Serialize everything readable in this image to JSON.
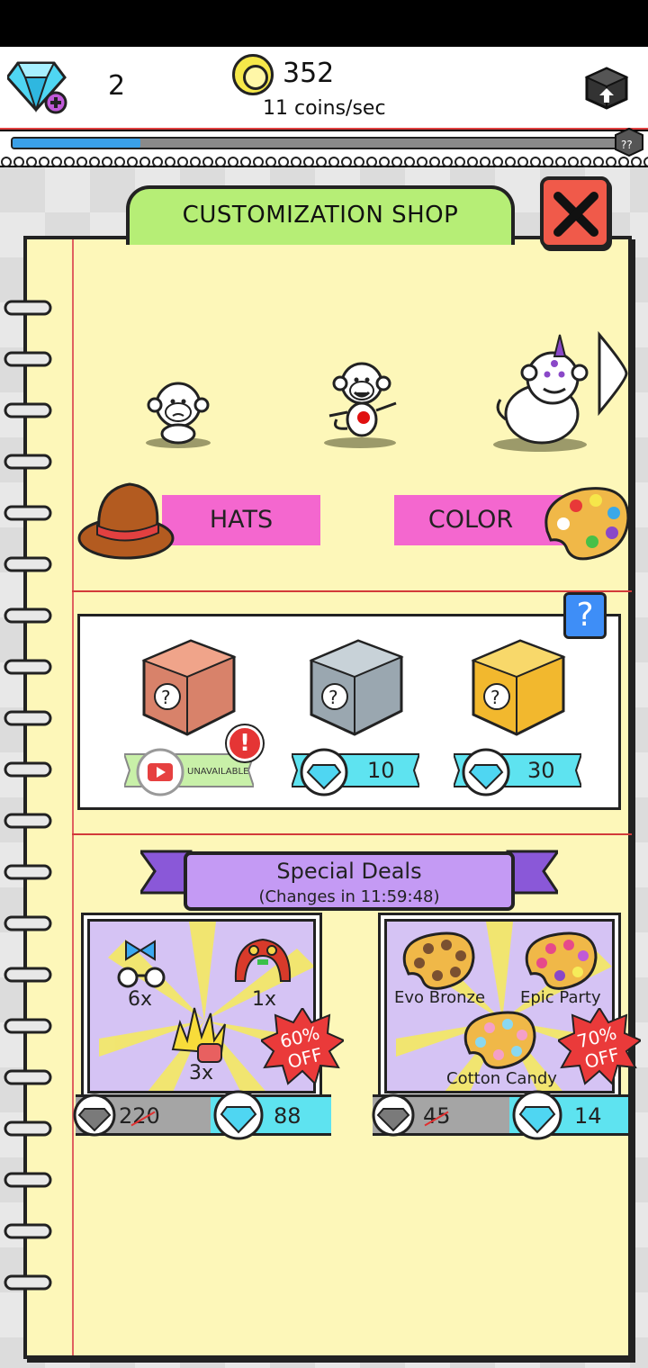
{
  "header": {
    "gems": "2",
    "coins": "352",
    "coin_rate": "11 coins/sec",
    "progress": 0.21
  },
  "shop": {
    "title": "CUSTOMIZATION SHOP",
    "hats_label": "HATS",
    "color_label": "COLOR"
  },
  "crates": [
    {
      "tier": "bronze",
      "price_label": "UNAVAILABLE"
    },
    {
      "tier": "silver",
      "price": "10"
    },
    {
      "tier": "gold",
      "price": "30"
    }
  ],
  "help_label": "?",
  "alert_label": "!",
  "deals": {
    "title": "Special Deals",
    "timer": "(Changes in 11:59:48)",
    "cards": [
      {
        "items": [
          {
            "icon": "bow-glasses-icon",
            "qty": "6x"
          },
          {
            "icon": "lion-dance-hat-icon",
            "qty": "1x"
          },
          {
            "icon": "golden-hair-icon",
            "qty": "3x"
          }
        ],
        "discount": "60%\nOFF",
        "old_price": "220",
        "new_price": "88"
      },
      {
        "items": [
          {
            "icon": "palette-icon",
            "label": "Evo Bronze"
          },
          {
            "icon": "palette-icon",
            "label": "Epic Party"
          },
          {
            "icon": "palette-icon",
            "label": "Cotton Candy"
          }
        ],
        "discount": "70%\nOFF",
        "old_price": "45",
        "new_price": "14"
      }
    ]
  },
  "colors": {
    "accent_green": "#b6ee76",
    "banner_pink": "#f467cf",
    "deal_purple": "#c49af4",
    "price_cyan": "#5ee3f0",
    "paper": "#fdf7b9"
  }
}
